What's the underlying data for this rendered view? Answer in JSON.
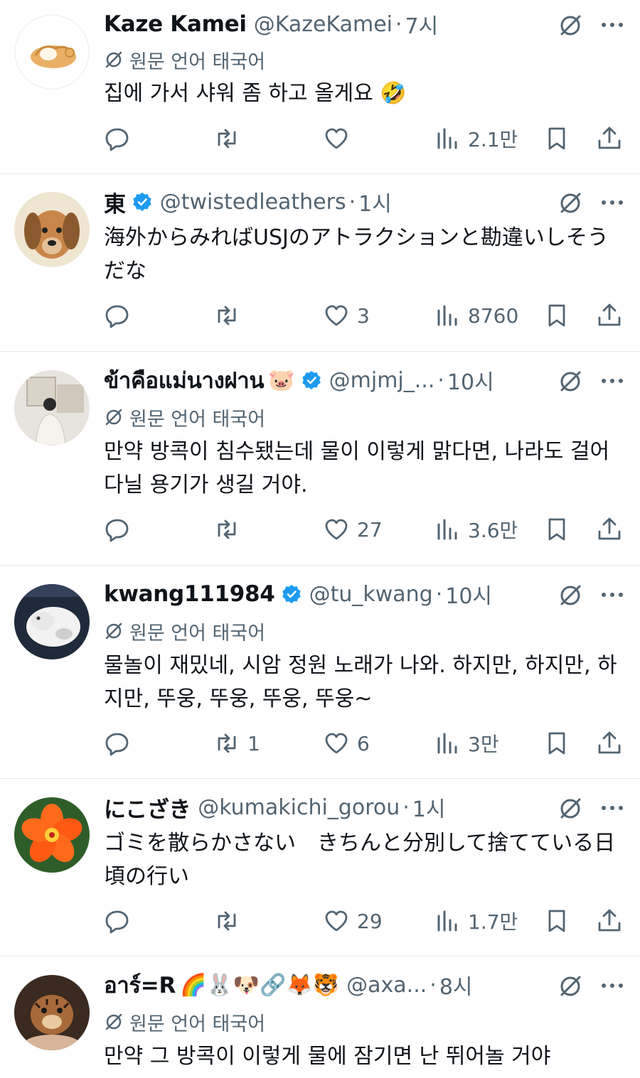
{
  "translation_label": "원문 언어 태국어",
  "tweets": [
    {
      "name": "Kaze Kamei",
      "name_emojis": "",
      "verified": false,
      "handle": "@KazeKamei",
      "time": "7시",
      "translated": true,
      "text": "집에 가서 샤워 좀 하고 올게요 🤣",
      "replies": "",
      "retweets": "",
      "likes": "",
      "views": "2.1만"
    },
    {
      "name": "東",
      "name_emojis": "",
      "verified": true,
      "handle": "@twistedleathers",
      "time": "1시",
      "translated": false,
      "text": "海外からみればUSJのアトラクションと勘違いしそうだな",
      "replies": "",
      "retweets": "",
      "likes": "3",
      "views": "8760"
    },
    {
      "name": "ข้าคือแม่นางฝาน",
      "name_emojis": "🐷",
      "verified": true,
      "handle": "@mjmj_...",
      "time": "10시",
      "translated": true,
      "text": "만약 방콕이 침수됐는데 물이 이렇게 맑다면, 나라도 걸어 다닐 용기가 생길 거야.",
      "replies": "",
      "retweets": "",
      "likes": "27",
      "views": "3.6만"
    },
    {
      "name": "kwang111984",
      "name_emojis": "",
      "verified": true,
      "handle": "@tu_kwang",
      "time": "10시",
      "translated": true,
      "text": "물놀이 재밌네, 시암 정원 노래가 나와. 하지만, 하지만, 하지만, 뚜웅, 뚜웅, 뚜웅, 뚜웅~",
      "replies": "",
      "retweets": "1",
      "likes": "6",
      "views": "3만"
    },
    {
      "name": "にこざき",
      "name_emojis": "",
      "verified": false,
      "handle": "@kumakichi_gorou",
      "time": "1시",
      "translated": false,
      "text": "ゴミを散らかさない　きちんと分別して捨てている日頃の行い",
      "replies": "",
      "retweets": "",
      "likes": "29",
      "views": "1.7만"
    },
    {
      "name": "อาร์=R",
      "name_emojis": "🌈🐰🐶🔗🦊🐯",
      "verified": false,
      "handle": "@axa...",
      "time": "8시",
      "translated": true,
      "text": "만약 그 방콕이 이렇게 물에 잠기면 난 뛰어놀 거야",
      "replies": "",
      "retweets": "",
      "likes": "",
      "views": ""
    }
  ],
  "icons": {
    "reply": "reply-icon",
    "retweet": "retweet-icon",
    "like": "heart-icon",
    "views": "views-icon",
    "bookmark": "bookmark-icon",
    "share": "share-icon",
    "grok": "grok-icon",
    "more": "more-icon",
    "verified": "verified-badge-icon",
    "translate": "translate-icon"
  },
  "colors": {
    "text": "#0f1419",
    "secondary": "#536471",
    "verified": "#1d9bf0",
    "divider": "#e6e9ec"
  }
}
